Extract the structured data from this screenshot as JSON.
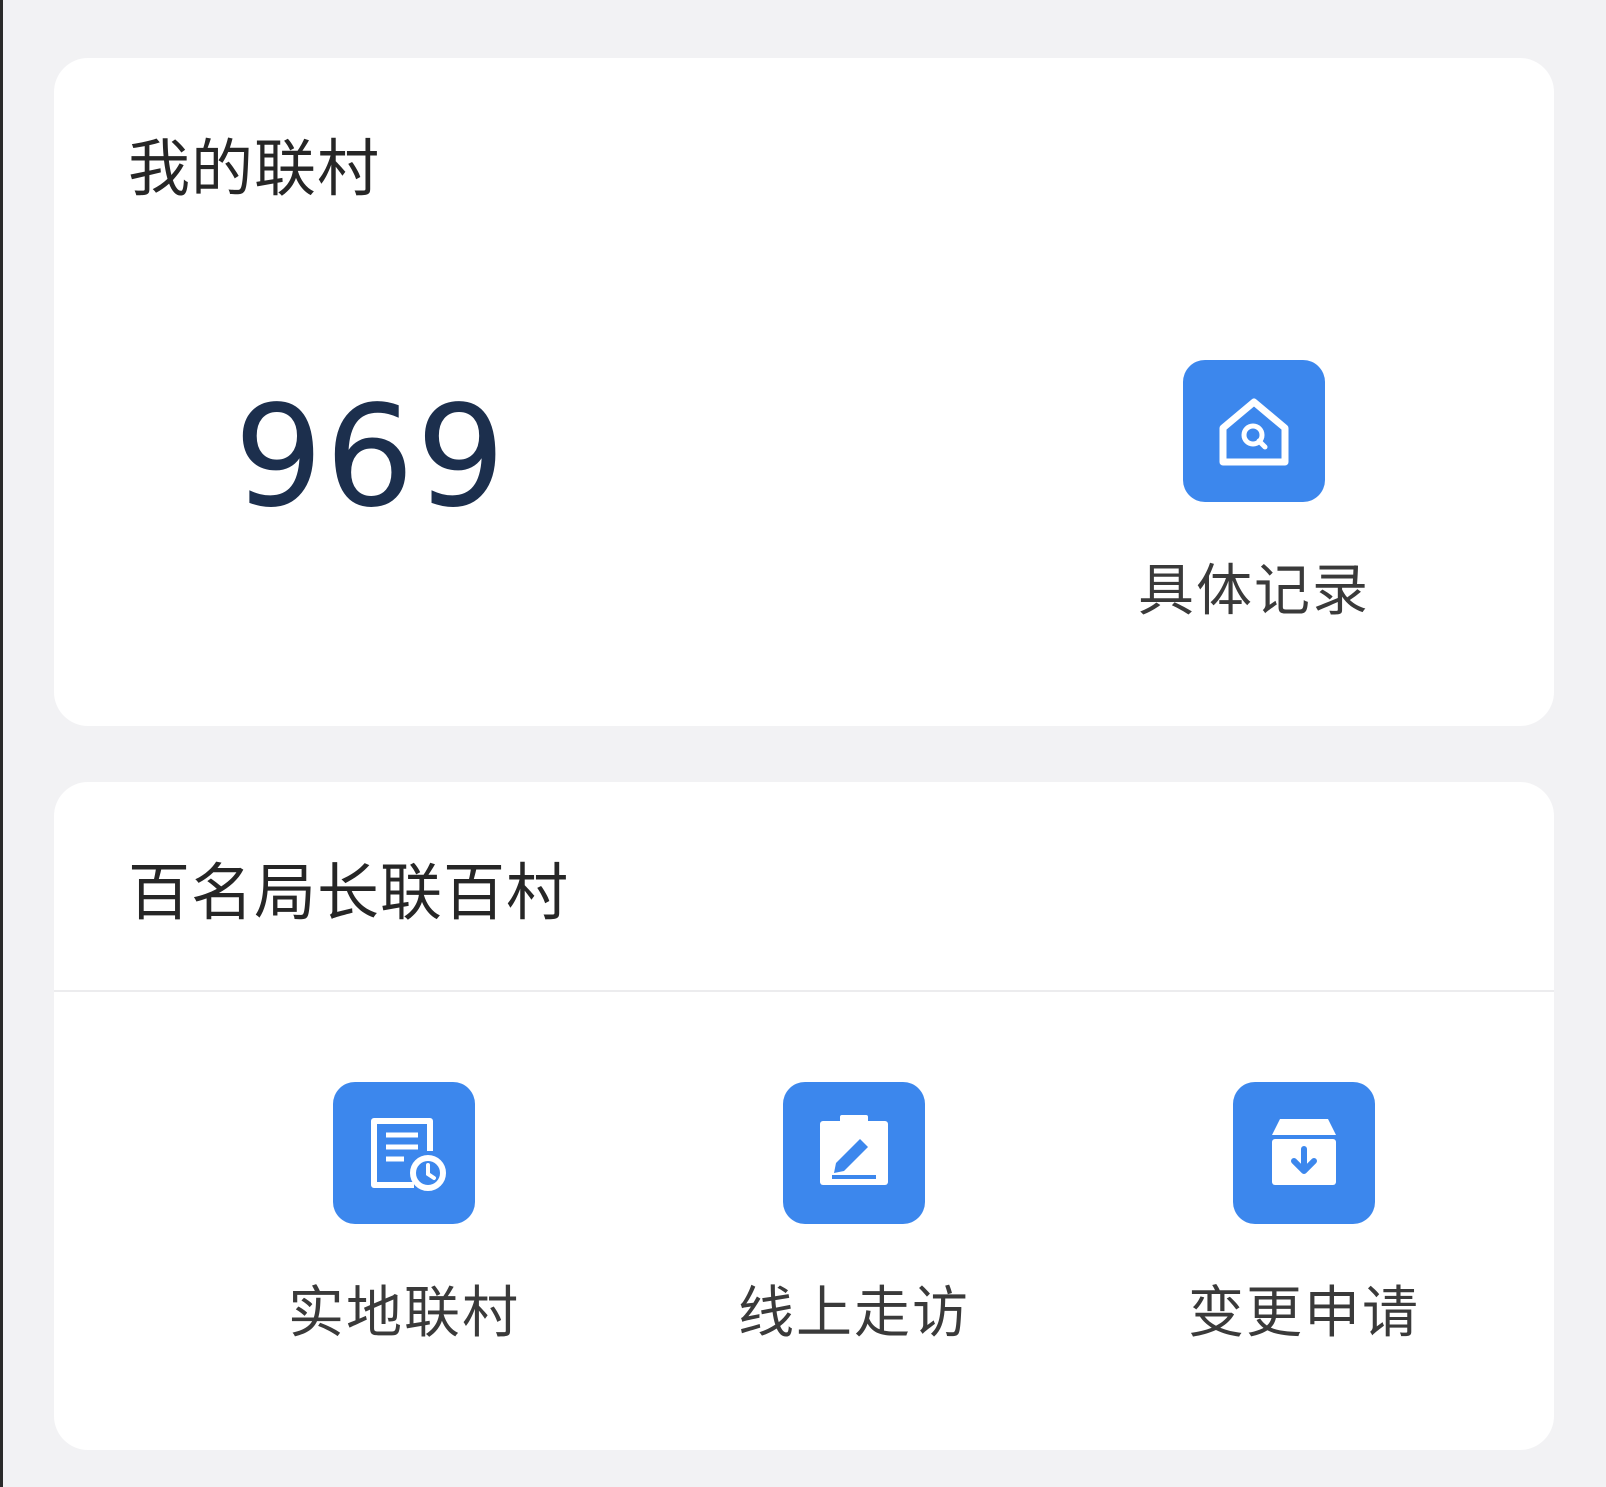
{
  "my_villages": {
    "title": "我的联村",
    "count": "969",
    "record_action": {
      "label": "具体记录",
      "icon": "house-search-icon"
    }
  },
  "program": {
    "title": "百名局长联百村",
    "actions": [
      {
        "label": "实地联村",
        "icon": "document-clock-icon"
      },
      {
        "label": "线上走访",
        "icon": "clipboard-edit-icon"
      },
      {
        "label": "变更申请",
        "icon": "archive-box-download-icon"
      }
    ]
  },
  "colors": {
    "accent": "#3c87ed",
    "background": "#f2f2f4",
    "card": "#ffffff",
    "number": "#1c2f4d"
  }
}
